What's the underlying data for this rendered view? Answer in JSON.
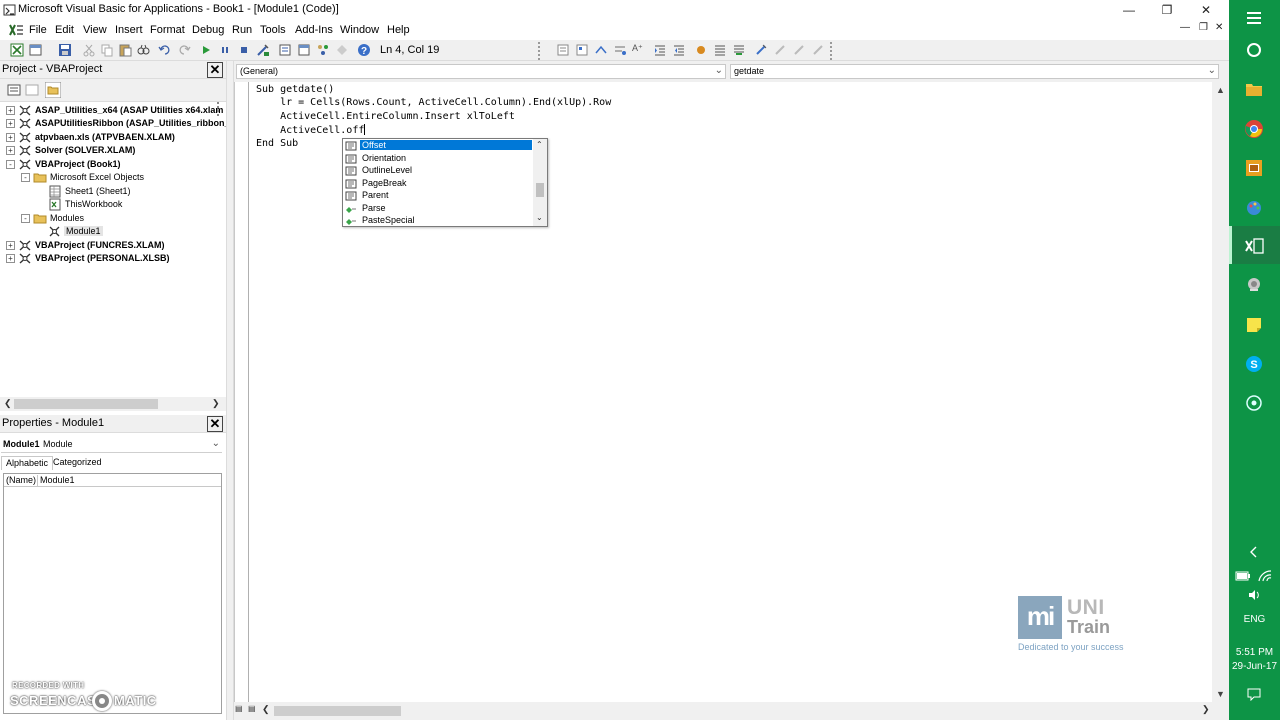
{
  "window": {
    "title": "Microsoft Visual Basic for Applications - Book1 - [Module1 (Code)]",
    "buttons": [
      "minimize",
      "restore",
      "close"
    ]
  },
  "menu": {
    "items": [
      "File",
      "Edit",
      "View",
      "Insert",
      "Format",
      "Debug",
      "Run",
      "Tools",
      "Add-Ins",
      "Window",
      "Help"
    ],
    "mdi_buttons": [
      "minimize",
      "restore",
      "close"
    ]
  },
  "toolbar": {
    "position": "Ln 4, Col 19"
  },
  "project": {
    "title": "Project - VBAProject",
    "tree": [
      {
        "label": "ASAP_Utilities_x64 (ASAP Utilities x64.xlam",
        "bold": true,
        "expander": "+",
        "icon": "vba-project-icon"
      },
      {
        "label": "ASAPUtilitiesRibbon (ASAP_Utilities_ribbon_",
        "bold": true,
        "expander": "+",
        "icon": "vba-project-icon"
      },
      {
        "label": "atpvbaen.xls (ATPVBAEN.XLAM)",
        "bold": true,
        "expander": "+",
        "icon": "vba-project-icon"
      },
      {
        "label": "Solver (SOLVER.XLAM)",
        "bold": true,
        "expander": "+",
        "icon": "vba-project-icon"
      },
      {
        "label": "VBAProject (Book1)",
        "bold": true,
        "expander": "-",
        "icon": "vba-project-icon"
      },
      {
        "label": "Microsoft Excel Objects",
        "bold": false,
        "expander": "-",
        "icon": "folder-icon"
      },
      {
        "label": "Sheet1 (Sheet1)",
        "bold": false,
        "expander": "",
        "icon": "sheet-icon"
      },
      {
        "label": "ThisWorkbook",
        "bold": false,
        "expander": "",
        "icon": "workbook-icon"
      },
      {
        "label": "Modules",
        "bold": false,
        "expander": "-",
        "icon": "folder-icon"
      },
      {
        "label": "Module1",
        "bold": false,
        "expander": "",
        "icon": "module-icon",
        "selected": true
      },
      {
        "label": "VBAProject (FUNCRES.XLAM)",
        "bold": true,
        "expander": "+",
        "icon": "vba-project-icon"
      },
      {
        "label": "VBAProject (PERSONAL.XLSB)",
        "bold": true,
        "expander": "+",
        "icon": "vba-project-icon"
      }
    ]
  },
  "properties": {
    "title": "Properties - Module1",
    "object_name": "Module1",
    "object_type": "Module",
    "tabs": [
      "Alphabetic",
      "Categorized"
    ],
    "rows": [
      {
        "key": "(Name)",
        "value": "Module1"
      }
    ]
  },
  "code": {
    "object_combo": "(General)",
    "procedure_combo": "getdate",
    "lines": [
      "Sub getdate()",
      "    lr = Cells(Rows.Count, ActiveCell.Column).End(xlUp).Row",
      "    ActiveCell.EntireColumn.Insert xlToLeft",
      "    ActiveCell.off",
      "End Sub"
    ]
  },
  "intellisense": {
    "items": [
      {
        "label": "Offset",
        "icon": "property-icon",
        "selected": true
      },
      {
        "label": "Orientation",
        "icon": "property-icon"
      },
      {
        "label": "OutlineLevel",
        "icon": "property-icon"
      },
      {
        "label": "PageBreak",
        "icon": "property-icon"
      },
      {
        "label": "Parent",
        "icon": "property-icon"
      },
      {
        "label": "Parse",
        "icon": "method-icon"
      },
      {
        "label": "PasteSpecial",
        "icon": "method-icon"
      }
    ]
  },
  "logo": {
    "mark": "mi",
    "name_top": "UNI",
    "name_bottom": "Train",
    "tagline": "Dedicated to your success"
  },
  "recorder": {
    "small": "RECORDED WITH",
    "brand_left": "SCREENCAST",
    "brand_right": "MATIC"
  },
  "taskbar": {
    "icons": [
      "action-center-icon",
      "cortana-icon",
      "file-explorer-icon",
      "chrome-icon",
      "powerpoint-icon",
      "paint-icon",
      "excel-icon",
      "network-app-icon",
      "sticky-notes-icon",
      "skype-icon",
      "app-circle-icon"
    ],
    "lang": "ENG",
    "time": "5:51 PM",
    "date": "29-Jun-17"
  },
  "colors": {
    "taskbar": "#0d9446",
    "selection": "#0078d7",
    "logo_blue": "#8aa6bd"
  }
}
